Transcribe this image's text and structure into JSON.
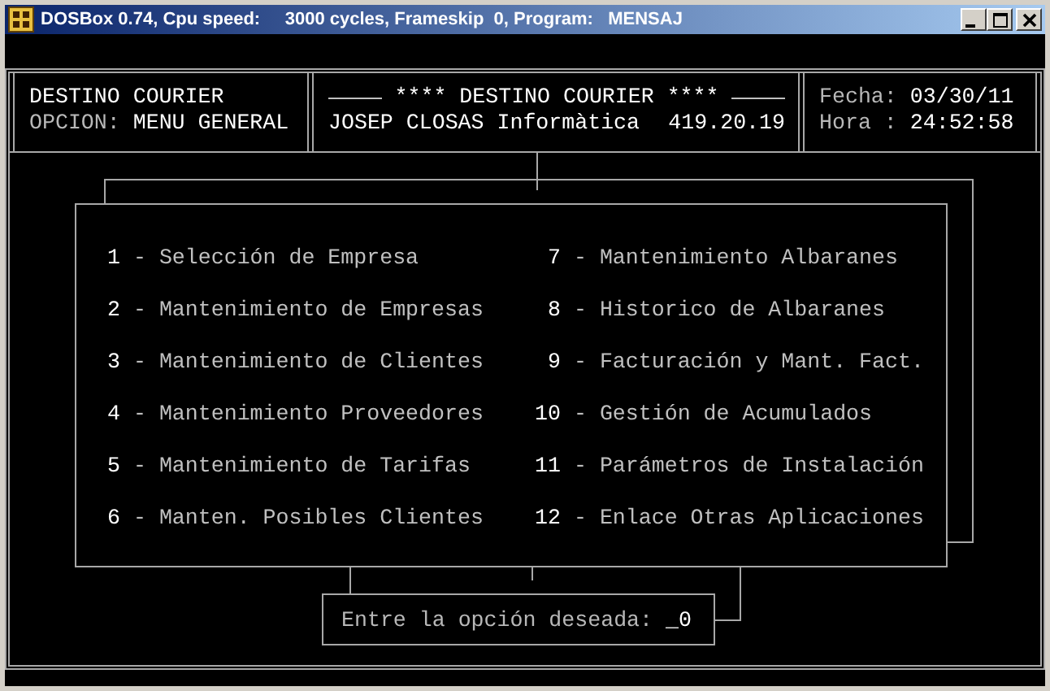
{
  "window": {
    "title": "DOSBox 0.74, Cpu speed:     3000 cycles, Frameskip  0, Program:   MENSAJ"
  },
  "header": {
    "app_name": "DESTINO COURIER",
    "option_label": "OPCION:",
    "option_value": "MENU GENERAL",
    "banner": "**** DESTINO COURIER ****",
    "company": "JOSEP CLOSAS Informàtica",
    "phone": "419.20.19",
    "date_label": "Fecha:",
    "date_value": "03/30/11",
    "time_label": "Hora :",
    "time_value": "24:52:58"
  },
  "menu": {
    "items": [
      {
        "number": "1",
        "dash": "-",
        "label": "Selección de Empresa"
      },
      {
        "number": "2",
        "dash": "-",
        "label": "Mantenimiento de Empresas"
      },
      {
        "number": "3",
        "dash": "-",
        "label": "Mantenimiento de Clientes"
      },
      {
        "number": "4",
        "dash": "-",
        "label": "Mantenimiento Proveedores"
      },
      {
        "number": "5",
        "dash": "-",
        "label": "Mantenimiento de Tarifas"
      },
      {
        "number": "6",
        "dash": "-",
        "label": "Manten. Posibles Clientes"
      },
      {
        "number": "7",
        "dash": "-",
        "label": "Mantenimiento Albaranes"
      },
      {
        "number": "8",
        "dash": "-",
        "label": "Historico de Albaranes"
      },
      {
        "number": "9",
        "dash": "-",
        "label": "Facturación y Mant. Fact."
      },
      {
        "number": "10",
        "dash": "-",
        "label": "Gestión de Acumulados"
      },
      {
        "number": "11",
        "dash": "-",
        "label": "Parámetros de Instalación"
      },
      {
        "number": "12",
        "dash": "-",
        "label": "Enlace Otras Aplicaciones"
      }
    ]
  },
  "prompt": {
    "label": "Entre la opción deseada:",
    "value": "_0"
  }
}
